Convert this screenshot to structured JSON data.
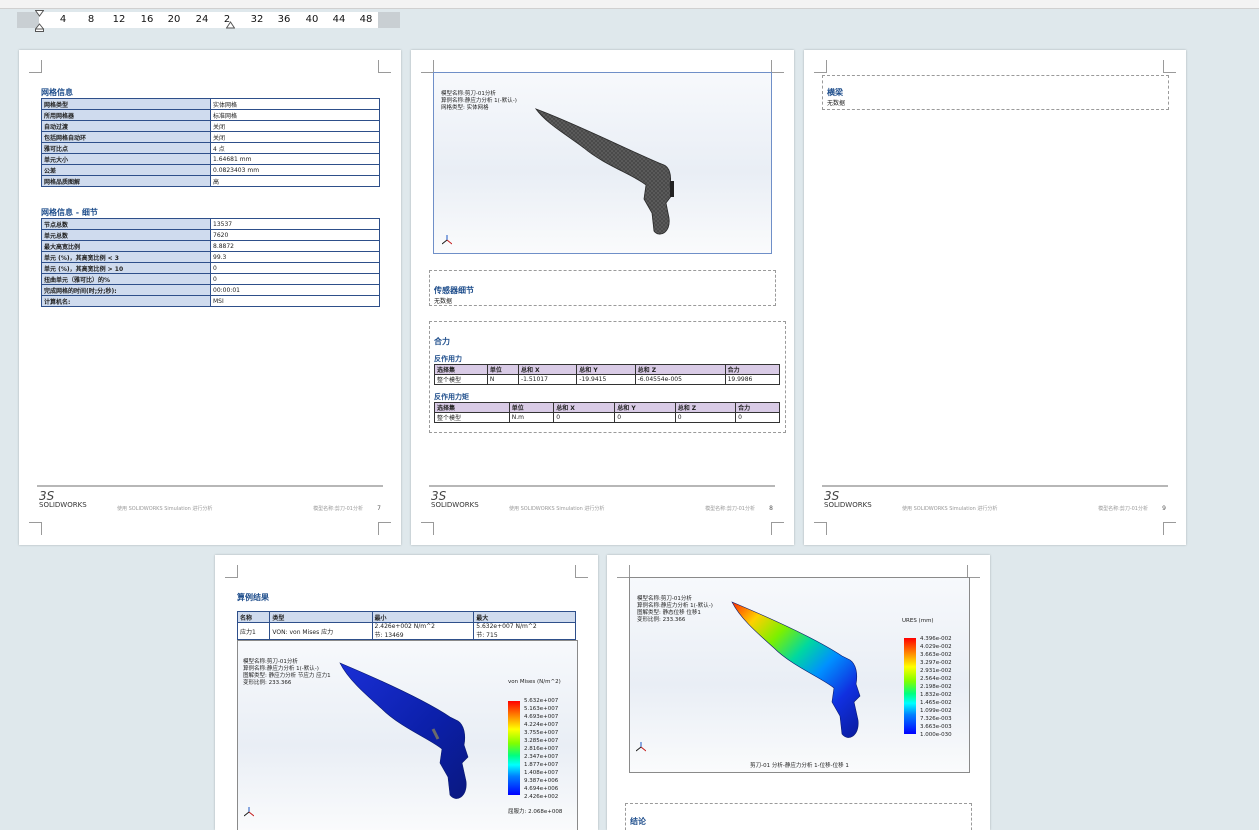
{
  "ruler": {
    "ticks": [
      "4",
      "8",
      "12",
      "16",
      "20",
      "24",
      "2",
      "32",
      "36",
      "40",
      "44",
      "48"
    ]
  },
  "page7": {
    "mesh_info_title": "网格信息",
    "mesh_info": [
      [
        "网格类型",
        "实体网格"
      ],
      [
        "所用网格器",
        "标准网格"
      ],
      [
        "自动过渡",
        "关闭"
      ],
      [
        "包括网格自动环",
        "关闭"
      ],
      [
        "雅可比点",
        "4 点"
      ],
      [
        "单元大小",
        "1.64681 mm"
      ],
      [
        "公差",
        "0.0823403 mm"
      ],
      [
        "网格品质图解",
        "高"
      ]
    ],
    "mesh_detail_title": "网格信息 - 细节",
    "mesh_detail": [
      [
        "节点总数",
        "13537"
      ],
      [
        "单元总数",
        "7620"
      ],
      [
        "最大高宽比例",
        "8.8872"
      ],
      [
        "单元 (%)，其高宽比例 < 3",
        "99.3"
      ],
      [
        "单元 (%)，其高宽比例 > 10",
        "0"
      ],
      [
        "扭曲单元（雅可比）的%",
        "0"
      ],
      [
        "完成网格的时间(时;分;秒):",
        "00:00:01"
      ],
      [
        "计算机名:",
        "MSI"
      ]
    ],
    "footer_logo": "SOLIDWORKS",
    "footer_text": "使用 SOLIDWORKS Simulation 进行分析",
    "footer_model": "模型名称:剪刀-01分析",
    "page_number": "7"
  },
  "page8": {
    "meta_lines": "模型名称:剪刀-01分析\n算例名称:静应力分析 1(-默认-)\n网格类型: 实体网格",
    "sensor_title": "传感器细节",
    "sensor_text": "无数据",
    "force_title": "合力",
    "reaction_force_title": "反作用力",
    "reaction_moment_title": "反作用力矩",
    "headers": [
      "选择集",
      "单位",
      "总和 X",
      "总和 Y",
      "总和 Z",
      "合力"
    ],
    "force_row": [
      "整个模型",
      "N",
      "-1.51017",
      "-19.9415",
      "-6.04554e-005",
      "19.9986"
    ],
    "moment_row": [
      "整个模型",
      "N.m",
      "0",
      "0",
      "0",
      "0"
    ],
    "footer_logo": "SOLIDWORKS",
    "footer_text": "使用 SOLIDWORKS Simulation 进行分析",
    "footer_model": "模型名称:剪刀-01分析",
    "page_number": "8"
  },
  "page9": {
    "beam_title": "横梁",
    "beam_text": "无数据",
    "footer_logo": "SOLIDWORKS",
    "footer_text": "使用 SOLIDWORKS Simulation 进行分析",
    "footer_model": "模型名称:剪刀-01分析",
    "page_number": "9"
  },
  "page10": {
    "title": "算例结果",
    "headers": [
      "名称",
      "类型",
      "最小",
      "最大"
    ],
    "row": [
      "应力1",
      "VON: von Mises 应力",
      "2.426e+002 N/m^2\n节: 13469",
      "5.632e+007 N/m^2\n节: 715"
    ],
    "meta_lines": "模型名称:剪刀-01分析\n算例名称:静应力分析 1(-默认-)\n图解类型: 静应力分析 节应力 应力1\n变形比例: 233.366",
    "legend_title": "von Mises (N/m^2)",
    "legend_values": [
      "5.632e+007",
      "5.163e+007",
      "4.693e+007",
      "4.224e+007",
      "3.755e+007",
      "3.285e+007",
      "2.816e+007",
      "2.347e+007",
      "1.877e+007",
      "1.408e+007",
      "9.387e+006",
      "4.694e+006",
      "2.426e+002"
    ],
    "yield": "屈服力: 2.068e+008"
  },
  "page11": {
    "meta_lines": "模型名称:剪刀-01分析\n算例名称:静应力分析 1(-默认-)\n图解类型: 静态位移 位移1\n变形比例: 233.366",
    "legend_title": "URES (mm)",
    "legend_values": [
      "4.396e-002",
      "4.029e-002",
      "3.663e-002",
      "3.297e-002",
      "2.931e-002",
      "2.564e-002",
      "2.198e-002",
      "1.832e-002",
      "1.465e-002",
      "1.099e-002",
      "7.326e-003",
      "3.663e-003",
      "1.000e-030"
    ],
    "caption": "剪刀-01 分析-静应力分析 1-位移-位移 1",
    "next_title": "结论"
  },
  "colors": {
    "table_header": "#cfdbee",
    "title_blue": "#1f4e8c",
    "page_bg": "#dfe8ec",
    "result_header": "#d9cbe6"
  }
}
